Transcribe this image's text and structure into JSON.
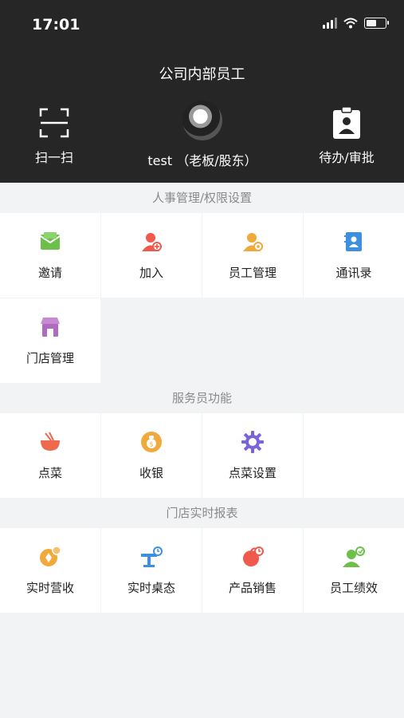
{
  "status_bar": {
    "time": "17:01"
  },
  "header": {
    "title": "公司内部员工",
    "scan_label": "扫一扫",
    "user_label": "test （老板/股东）",
    "todo_label": "待办/审批"
  },
  "sections": {
    "hr": {
      "title": "人事管理/权限设置",
      "items": [
        {
          "label": "邀请",
          "icon": "envelope-icon",
          "color": "#6cc04a"
        },
        {
          "label": "加入",
          "icon": "user-add-icon",
          "color": "#ef5a4c"
        },
        {
          "label": "员工管理",
          "icon": "user-manage-icon",
          "color": "#f0a93a"
        },
        {
          "label": "通讯录",
          "icon": "contacts-icon",
          "color": "#3d8fe0"
        },
        {
          "label": "门店管理",
          "icon": "store-icon",
          "color": "#b06ac0"
        }
      ]
    },
    "waiter": {
      "title": "服务员功能",
      "items": [
        {
          "label": "点菜",
          "icon": "bowl-icon",
          "color": "#ef6a4c"
        },
        {
          "label": "收银",
          "icon": "money-bag-icon",
          "color": "#f0a93a"
        },
        {
          "label": "点菜设置",
          "icon": "gear-icon",
          "color": "#7a64d8"
        }
      ]
    },
    "report": {
      "title": "门店实时报表",
      "items": [
        {
          "label": "实时营收",
          "icon": "revenue-icon",
          "color": "#f0a93a"
        },
        {
          "label": "实时桌态",
          "icon": "table-status-icon",
          "color": "#3d8fe0"
        },
        {
          "label": "产品销售",
          "icon": "product-sales-icon",
          "color": "#ef5a4c"
        },
        {
          "label": "员工绩效",
          "icon": "performance-icon",
          "color": "#6cc04a"
        }
      ]
    }
  }
}
